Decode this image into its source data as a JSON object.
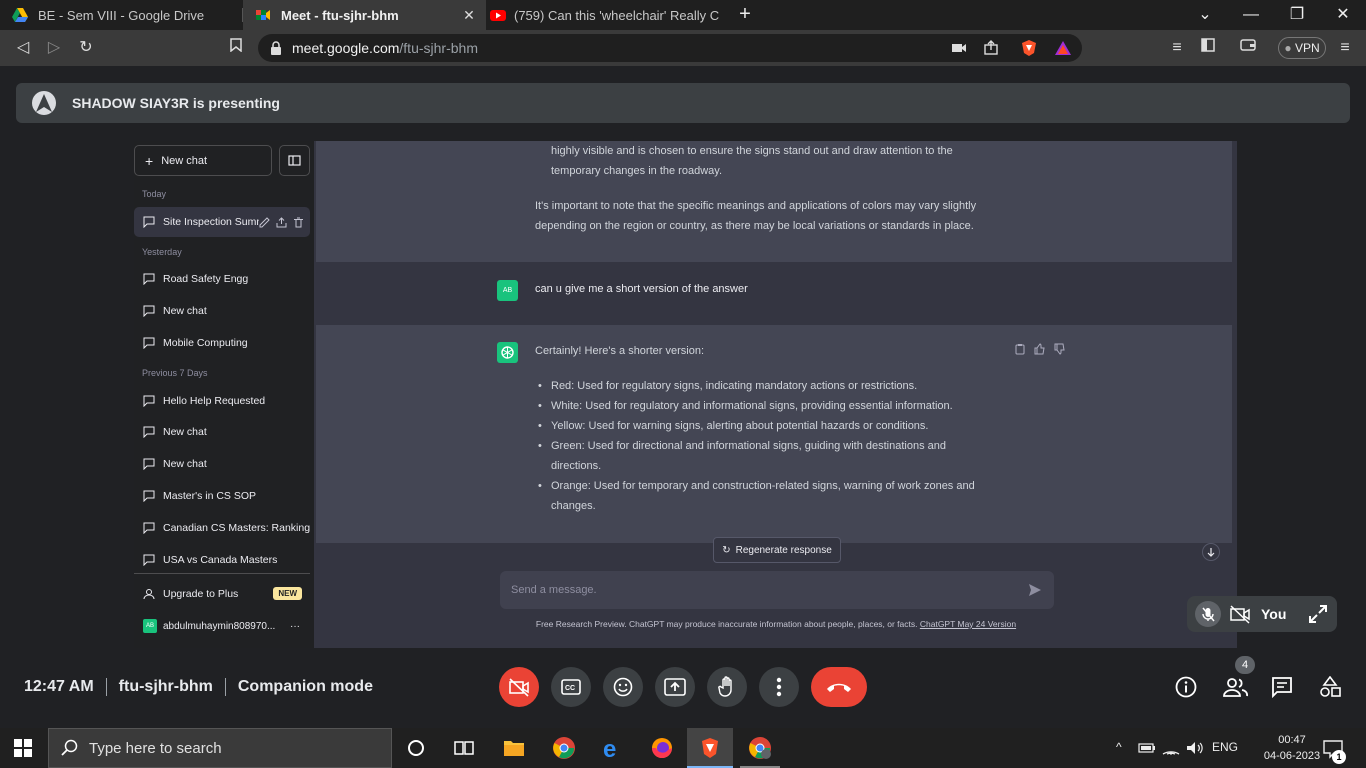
{
  "browser": {
    "tabs": [
      {
        "title": "BE - Sem VIII - Google Drive",
        "active": false
      },
      {
        "title": "Meet - ftu-sjhr-bhm",
        "active": true
      },
      {
        "title": "(759) Can this 'wheelchair' Really Climb",
        "active": false
      }
    ],
    "url_host": "meet.google.com",
    "url_path": "/ftu-sjhr-bhm",
    "vpn_label": "VPN"
  },
  "meet": {
    "presenting_text": "SHADOW SIAY3R is presenting",
    "time": "12:47 AM",
    "meeting_code": "ftu-sjhr-bhm",
    "mode": "Companion mode",
    "participant_count": "4",
    "self_label": "You"
  },
  "chatgpt": {
    "new_chat_label": "New chat",
    "groups": {
      "today": "Today",
      "yesterday": "Yesterday",
      "previous_7_days": "Previous 7 Days"
    },
    "today_items": [
      "Site Inspection Summary"
    ],
    "yesterday_items": [
      "Road Safety Engg",
      "New chat",
      "Mobile Computing"
    ],
    "previous_items": [
      "Hello Help Requested",
      "New chat",
      "New chat",
      "Master's in CS SOP",
      "Canadian CS Masters: Ranking",
      "USA vs Canada Masters"
    ],
    "upgrade_label": "Upgrade to Plus",
    "new_badge": "NEW",
    "account_avatar": "AB",
    "account_name": "abdulmuhaymin808970...",
    "account_more": "···",
    "conversation": {
      "prev_line_1": "highly visible and is chosen to ensure the signs stand out and draw attention to the",
      "prev_line_2": "temporary changes in the roadway.",
      "note_line_1": "It's important to note that the specific meanings and applications of colors may vary slightly",
      "note_line_2": "depending on the region or country, as there may be local variations or standards in place.",
      "user_avatar": "AB",
      "user_message": "can u give me a short version of the answer",
      "reply_intro": "Certainly! Here's a shorter version:",
      "bullets": [
        {
          "l1": "Red: Used for regulatory signs, indicating mandatory actions or restrictions.",
          "l2": ""
        },
        {
          "l1": "White: Used for regulatory and informational signs, providing essential information.",
          "l2": ""
        },
        {
          "l1": "Yellow: Used for warning signs, alerting about potential hazards or conditions.",
          "l2": ""
        },
        {
          "l1": "Green: Used for directional and informational signs, guiding with destinations and",
          "l2": "directions."
        },
        {
          "l1": "Orange: Used for temporary and construction-related signs, warning of work zones and",
          "l2": "changes."
        }
      ]
    },
    "regenerate_label": "Regenerate response",
    "input_placeholder": "Send a message.",
    "disclaimer_text": "Free Research Preview. ChatGPT may produce inaccurate information about people, places, or facts. ",
    "disclaimer_link": "ChatGPT May 24 Version"
  },
  "taskbar": {
    "search_placeholder": "Type here to search",
    "lang": "ENG",
    "clock_time": "00:47",
    "clock_date": "04-06-2023",
    "notification_count": "1"
  },
  "colors": {
    "meet_bg": "#202124",
    "chatgpt_sidebar": "#202123",
    "chatgpt_main": "#343541",
    "chatgpt_bot_row": "#444654",
    "gpt_green": "#19c37d",
    "hangup_red": "#ea4335"
  }
}
